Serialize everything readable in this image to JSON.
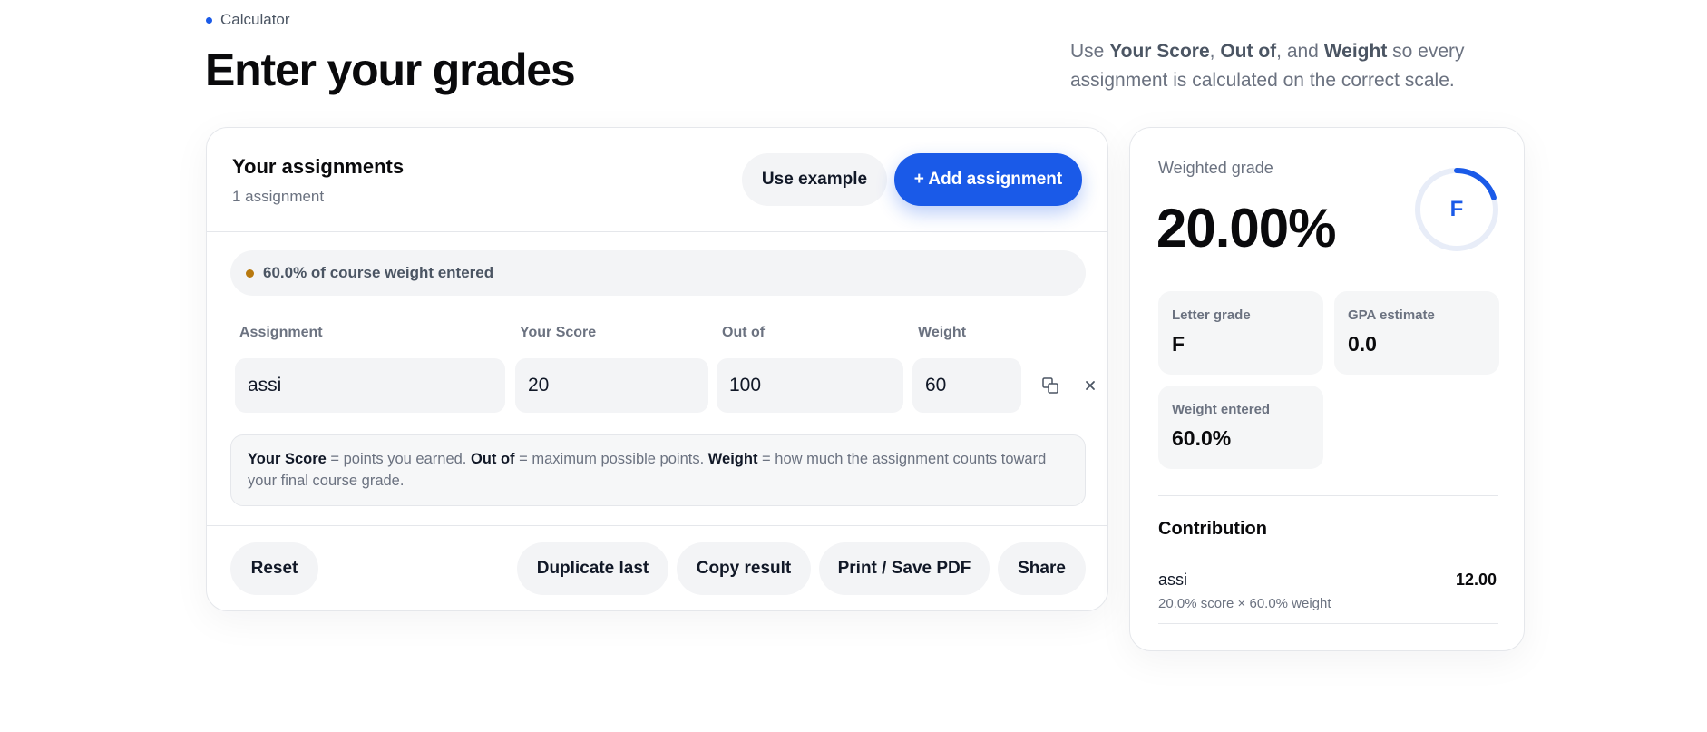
{
  "header": {
    "eyebrow": "Calculator",
    "title": "Enter your grades",
    "intro": {
      "use": "Use ",
      "score": "Your Score",
      "comma1": ", ",
      "outof": "Out of",
      "comma2": ", and ",
      "weight": "Weight",
      "rest": " so every assignment is calculated on the correct scale."
    }
  },
  "assignments": {
    "title": "Your assignments",
    "count": "1 assignment",
    "use_example": "Use example",
    "add": "+ Add assignment",
    "weight_status": "60.0% of course weight entered",
    "columns": {
      "name": "Assignment",
      "score": "Your Score",
      "outof": "Out of",
      "weight": "Weight"
    },
    "rows": [
      {
        "name": "assi",
        "score": "20",
        "outof": "100",
        "weight": "60"
      }
    ],
    "help": {
      "score": "Your Score",
      "score_desc": " = points you earned. ",
      "outof": "Out of",
      "outof_desc": " = maximum possible points. ",
      "weight": "Weight",
      "weight_desc": " = how much the assignment counts toward your final course grade."
    },
    "footer": {
      "reset": "Reset",
      "duplicate": "Duplicate last",
      "copy": "Copy result",
      "print": "Print / Save PDF",
      "share": "Share"
    }
  },
  "result": {
    "label": "Weighted grade",
    "value": "20.00%",
    "letter": "F",
    "ring_progress": 0.2,
    "stats": {
      "letter_label": "Letter grade",
      "letter_value": "F",
      "gpa_label": "GPA estimate",
      "gpa_value": "0.0",
      "weight_label": "Weight entered",
      "weight_value": "60.0%"
    },
    "contribution": {
      "title": "Contribution",
      "items": [
        {
          "name": "assi",
          "detail": "20.0% score × 60.0% weight",
          "value": "12.00"
        }
      ]
    }
  },
  "colors": {
    "accent": "#1a5ae8",
    "warning_dot": "#b8790f",
    "muted_text": "#6b7280",
    "surface": "#f3f4f6"
  }
}
